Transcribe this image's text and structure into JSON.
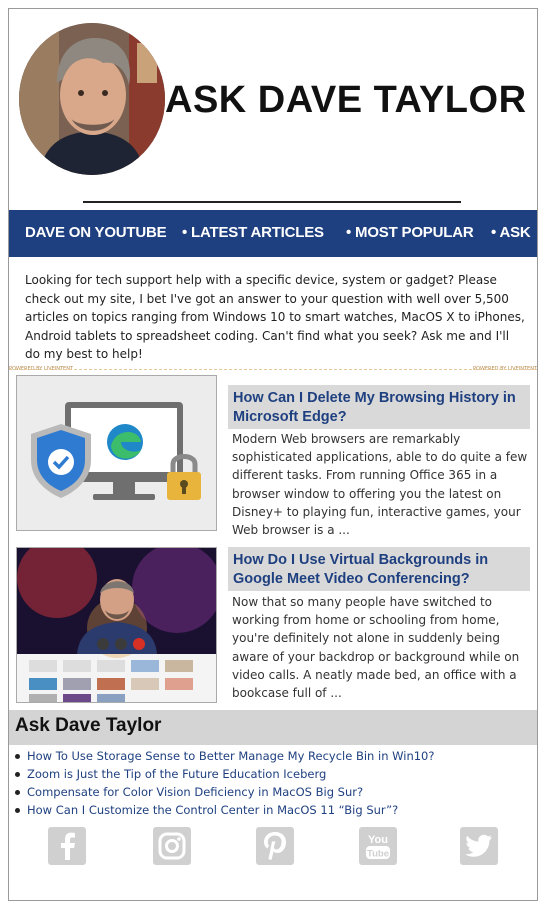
{
  "site": {
    "title": "ASK DAVE TAYLOR"
  },
  "nav": {
    "items": [
      {
        "label": "DAVE ON YOUTUBE"
      },
      {
        "label": "• LATEST ARTICLES"
      },
      {
        "label": "• MOST POPULAR"
      },
      {
        "label": "• ASK"
      }
    ]
  },
  "intro": {
    "text": "Looking for tech support help with a specific device, system or gadget? Please check out my site, I bet I've got an answer to your question with well over 5,500 articles on topics ranging from Windows 10 to smart watches, MacOS X to iPhones, Android tablets to spreadsheet coding. Can't find what you seek? Ask me and I'll do my best to help!"
  },
  "powered_by": {
    "left": "POWERED BY LIVEINTENT",
    "right": "POWERED BY LIVEINTENT"
  },
  "articles": [
    {
      "title": "How Can I Delete My Browsing History in Microsoft Edge?",
      "excerpt": "Modern Web browsers are remarkably sophisticated applications, able to do quite a few different tasks. From running Office 365 in a browser window to offering you the latest on Disney+ to playing fun, interactive games, your Web browser is a ..."
    },
    {
      "title": "How Do I Use Virtual Backgrounds in Google Meet Video Conferencing?",
      "excerpt": "Now that so many people have switched to working from home or schooling from home, you're definitely not alone in suddenly being aware of your backdrop or background while on video calls. A neatly made bed, an office with a bookcase full of ..."
    }
  ],
  "section": {
    "title": "Ask Dave Taylor",
    "links": [
      "How To Use Storage Sense to Better Manage My Recycle Bin in Win10?",
      "Zoom is Just the Tip of the Future Education Iceberg",
      "Compensate for Color Vision Deficiency in MacOS Big Sur?",
      "How Can I Customize the Control Center in MacOS 11 “Big Sur”?"
    ]
  },
  "social": {
    "icons": [
      "facebook-icon",
      "instagram-icon",
      "pinterest-icon",
      "youtube-icon",
      "twitter-icon"
    ],
    "youtube_label": "You Tube",
    "color": "#d0d0d0"
  },
  "colors": {
    "nav_bg": "#1f4080",
    "link": "#1f4080",
    "title_box": "#d9d9d9"
  }
}
